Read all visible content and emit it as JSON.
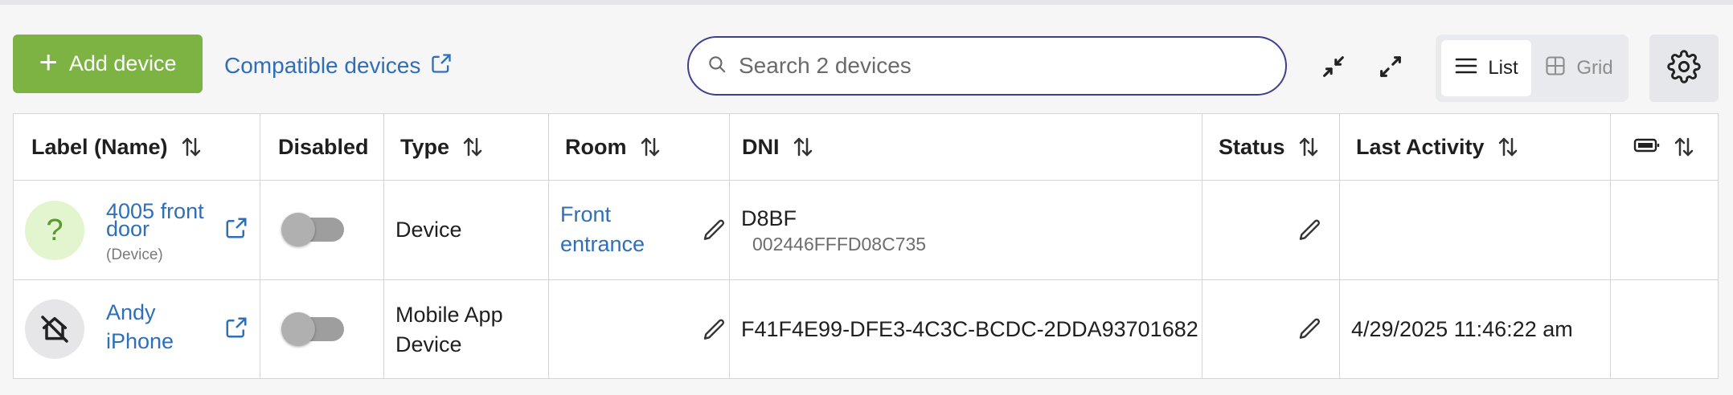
{
  "toolbar": {
    "add_label": "Add device",
    "compatible_label": "Compatible devices",
    "search_placeholder": "Search 2 devices",
    "search_value": "",
    "view_list_label": "List",
    "view_grid_label": "Grid",
    "active_view": "List"
  },
  "table": {
    "headers": {
      "label": "Label (Name)",
      "disabled": "Disabled",
      "type": "Type",
      "room": "Room",
      "dni": "DNI",
      "status": "Status",
      "last_activity": "Last Activity",
      "battery_icon": "battery-icon"
    },
    "rows": [
      {
        "avatar_symbol": "?",
        "avatar_icon": "question-mark-icon",
        "name_line1": "4005 front",
        "name_line2": "door",
        "sub": "(Device)",
        "disabled": false,
        "type_line1": "Device",
        "type_line2": "",
        "room_line1": "Front",
        "room_line2": "entrance",
        "dni": "D8BF",
        "dni_sub": "002446FFFD08C735",
        "status": "",
        "last_activity": ""
      },
      {
        "avatar_icon": "disabled-home-icon",
        "name_line1": "Andy",
        "name_line2": "iPhone",
        "sub": "",
        "disabled": false,
        "type_line1": "Mobile App",
        "type_line2": "Device",
        "room_line1": "",
        "room_line2": "",
        "dni": "F41F4E99-DFE3-4C3C-BCDC-2DDA93701682",
        "dni_sub": "",
        "status": "",
        "last_activity": "4/29/2025 11:46:22 am"
      }
    ]
  },
  "colors": {
    "accent_green": "#7cb342",
    "link_blue": "#2f6fba",
    "search_border": "#3e3f8f"
  }
}
